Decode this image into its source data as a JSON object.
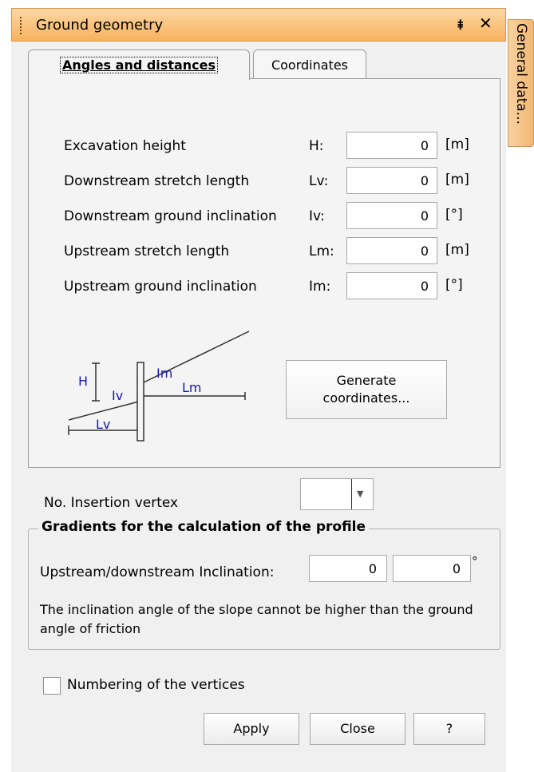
{
  "window": {
    "title": "Ground geometry",
    "pin_glyph": "⯒",
    "close_glyph": "✕",
    "side_tab_label": "General data..."
  },
  "tabs": [
    {
      "label": "Angles and distances",
      "active": true
    },
    {
      "label": "Coordinates",
      "active": false
    }
  ],
  "fields": [
    {
      "label": "Excavation height",
      "symbol": "H:",
      "value": "0",
      "unit": "[m]"
    },
    {
      "label": "Downstream stretch length",
      "symbol": "Lv:",
      "value": "0",
      "unit": "[m]"
    },
    {
      "label": "Downstream ground inclination",
      "symbol": "Iv:",
      "value": "0",
      "unit": "[°]"
    },
    {
      "label": "Upstream stretch length",
      "symbol": "Lm:",
      "value": "0",
      "unit": "[m]"
    },
    {
      "label": "Upstream ground inclination",
      "symbol": "Im:",
      "value": "0",
      "unit": "[°]"
    }
  ],
  "diagram": {
    "labels": {
      "H": "H",
      "Iv": "Iv",
      "Lv": "Lv",
      "Im": "Im",
      "Lm": "Lm"
    }
  },
  "generate_button": {
    "line1": "Generate",
    "line2": "coordinates..."
  },
  "insertion_vertex": {
    "label": "No. Insertion vertex",
    "value": ""
  },
  "gradients": {
    "title": "Gradients for the calculation of the profile",
    "label": "Upstream/downstream Inclination:",
    "upstream_value": "0",
    "downstream_value": "0",
    "unit": "°",
    "note": "The inclination angle of the slope cannot be higher than the ground angle of friction"
  },
  "numbering": {
    "label": "Numbering of the vertices",
    "checked": false
  },
  "buttons": {
    "apply": "Apply",
    "close": "Close",
    "help": "?"
  },
  "colors": {
    "titlebar": "#f7b25e",
    "diagram_text": "#1a1aa6",
    "panel": "#f0f0f0"
  }
}
